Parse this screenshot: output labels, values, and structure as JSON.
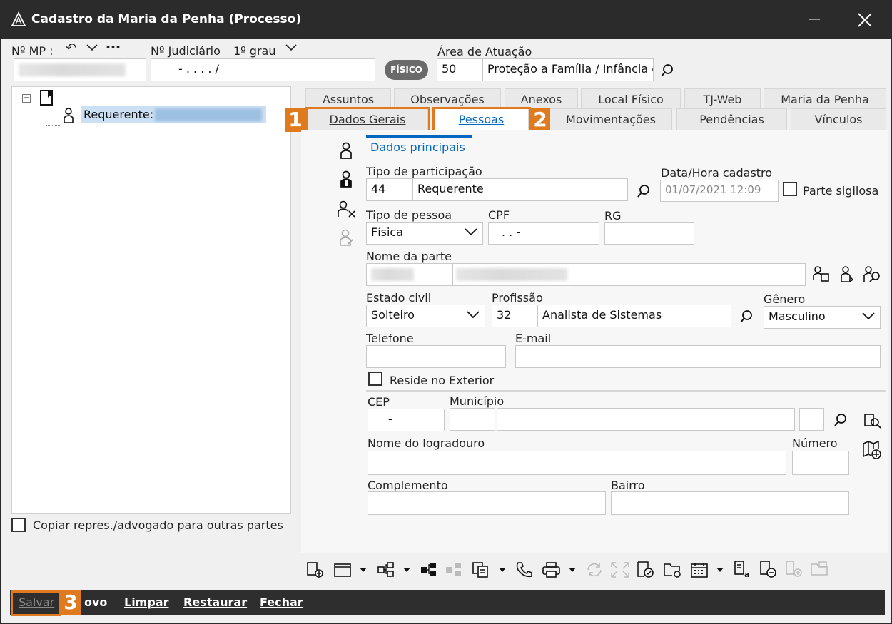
{
  "window": {
    "title": "Cadastro da Maria da Penha (Processo)",
    "minimize_glyph": "—",
    "close_glyph": "✕"
  },
  "header": {
    "mp_label": "Nº MP :",
    "mp_undo": "↶",
    "mp_more": "•••",
    "judicial_label": "Nº Judiciário",
    "grau_label": "1º grau",
    "judicial_value": "- .   . . .    /",
    "fisico_label": "FÍSICO",
    "area_label": "Área de Atuação",
    "area_code": "50",
    "area_name": "Proteção a Família / Infância e"
  },
  "tree": {
    "root_node": "",
    "child_label": "Requerente:",
    "copy_label": "Copiar repres./advogado para outras partes"
  },
  "tabs_row1": [
    {
      "label": "Assuntos"
    },
    {
      "label": "Observações"
    },
    {
      "label": "Anexos"
    },
    {
      "label": "Local Físico"
    },
    {
      "label": "TJ-Web"
    },
    {
      "label": "Maria da Penha"
    }
  ],
  "tabs_row2": [
    {
      "label": "Dados Gerais"
    },
    {
      "label": "Pessoas",
      "active": true
    },
    {
      "label": "Movimentações"
    },
    {
      "label": "Pendências"
    },
    {
      "label": "Vínculos"
    }
  ],
  "subtab": {
    "label": "Dados principais"
  },
  "form": {
    "tipo_participacao_label": "Tipo de participação",
    "tipo_participacao_code": "44",
    "tipo_participacao_name": "Requerente",
    "data_hora_label": "Data/Hora cadastro",
    "data_hora_value": "01/07/2021 12:09",
    "parte_sigilosa_label": "Parte sigilosa",
    "tipo_pessoa_label": "Tipo de pessoa",
    "tipo_pessoa_value": "Física",
    "cpf_label": "CPF",
    "cpf_value": ". .   -",
    "rg_label": "RG",
    "rg_value": "",
    "nome_label": "Nome da parte",
    "estado_civil_label": "Estado civil",
    "estado_civil_value": "Solteiro",
    "profissao_label": "Profissão",
    "profissao_code": "32",
    "profissao_name": "Analista de Sistemas",
    "genero_label": "Gênero",
    "genero_value": "Masculino",
    "telefone_label": "Telefone",
    "telefone_value": "",
    "email_label": "E-mail",
    "email_value": "",
    "reside_exterior_label": "Reside no Exterior",
    "cep_label": "CEP",
    "cep_value": "-",
    "municipio_label": "Município",
    "municipio_value": "",
    "logradouro_label": "Nome do logradouro",
    "logradouro_value": "",
    "numero_label": "Número",
    "numero_value": "",
    "complemento_label": "Complemento",
    "complemento_value": "",
    "bairro_label": "Bairro",
    "bairro_value": ""
  },
  "annotations": {
    "one": "1",
    "two": "2",
    "three": "3"
  },
  "bottom": {
    "salvar": "Salvar",
    "novo": "ovo",
    "limpar": "Limpar",
    "restaurar": "Restaurar",
    "fechar": "Fechar"
  },
  "colors": {
    "accent": "#0067c0",
    "annotation": "#e07a1e",
    "titlebar": "#2b2b2b"
  }
}
